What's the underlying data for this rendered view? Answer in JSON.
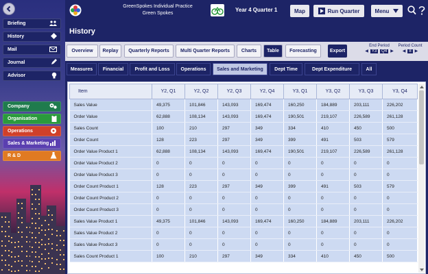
{
  "sidebar": {
    "top_items": [
      {
        "label": "Briefing",
        "icon": "people-icon"
      },
      {
        "label": "History",
        "icon": "history-icon"
      },
      {
        "label": "Mail",
        "icon": "mail-icon"
      },
      {
        "label": "Journal",
        "icon": "pen-icon"
      },
      {
        "label": "Advisor",
        "icon": "lightbulb-icon"
      }
    ],
    "dept_items": [
      {
        "label": "Company",
        "icon": "gears-icon",
        "color": "#1f7b4d"
      },
      {
        "label": "Organisation",
        "icon": "clipboard-icon",
        "color": "#2a9a3c"
      },
      {
        "label": "Operations",
        "icon": "cogs-icon",
        "color": "#d0402a"
      },
      {
        "label": "Sales & Marketing",
        "icon": "bar-chart-icon",
        "color": "#5a3fb0"
      },
      {
        "label": "R & D",
        "icon": "flask-icon",
        "color": "#e07a22"
      }
    ]
  },
  "header": {
    "title_line1": "GreenSpokes Individual Practice",
    "title_line2": "Green Spokes",
    "quarter": "Year 4 Quarter 1",
    "map_label": "Map",
    "run_label": "Run Quarter",
    "menu_label": "Menu"
  },
  "page": {
    "title": "History",
    "tabs": [
      "Overview",
      "Replay",
      "Quarterly Reports",
      "Multi Quarter Reports",
      "Charts",
      "Table",
      "Forecasting"
    ],
    "active_tab": "Table",
    "export_label": "Export",
    "end_period": {
      "label": "End Period",
      "year": "Y3",
      "quarter": "Q4"
    },
    "period_count": {
      "label": "Period Count",
      "value": "8"
    },
    "subtabs": [
      "Measures",
      "Financial",
      "Profit and Loss",
      "Operations",
      "Sales and Marketing",
      "Dept Time",
      "Dept Expenditure",
      "All"
    ],
    "active_subtab": "Sales and Marketing"
  },
  "table": {
    "columns": [
      "Item",
      "Y2, Q1",
      "Y2, Q2",
      "Y2, Q3",
      "Y2, Q4",
      "Y3, Q1",
      "Y3, Q2",
      "Y3, Q3",
      "Y3, Q4"
    ],
    "rows": [
      [
        "Sales Value",
        "49,375",
        "101,846",
        "143,093",
        "169,474",
        "160,250",
        "184,889",
        "203,111",
        "226,202"
      ],
      [
        "Order Value",
        "62,888",
        "108,134",
        "143,093",
        "169,474",
        "190,501",
        "219,107",
        "226,589",
        "261,128"
      ],
      [
        "Sales Count",
        "100",
        "210",
        "297",
        "349",
        "334",
        "410",
        "450",
        "500"
      ],
      [
        "Order Count",
        "128",
        "223",
        "297",
        "349",
        "399",
        "491",
        "503",
        "579"
      ],
      [
        "Order Value Product 1",
        "62,888",
        "108,134",
        "143,093",
        "169,474",
        "190,501",
        "219,107",
        "226,589",
        "261,128"
      ],
      [
        "Order Value Product 2",
        "0",
        "0",
        "0",
        "0",
        "0",
        "0",
        "0",
        "0"
      ],
      [
        "Order Value Product 3",
        "0",
        "0",
        "0",
        "0",
        "0",
        "0",
        "0",
        "0"
      ],
      [
        "Order Count Product 1",
        "128",
        "223",
        "297",
        "349",
        "399",
        "491",
        "503",
        "579"
      ],
      [
        "Order Count Product 2",
        "0",
        "0",
        "0",
        "0",
        "0",
        "0",
        "0",
        "0"
      ],
      [
        "Order Count Product 3",
        "0",
        "0",
        "0",
        "0",
        "0",
        "0",
        "0",
        "0"
      ],
      [
        "Sales Value Product 1",
        "49,375",
        "101,846",
        "143,093",
        "169,474",
        "160,250",
        "184,889",
        "203,111",
        "226,202"
      ],
      [
        "Sales Value Product 2",
        "0",
        "0",
        "0",
        "0",
        "0",
        "0",
        "0",
        "0"
      ],
      [
        "Sales Value Product 3",
        "0",
        "0",
        "0",
        "0",
        "0",
        "0",
        "0",
        "0"
      ],
      [
        "Sales Count Product 1",
        "100",
        "210",
        "297",
        "349",
        "334",
        "410",
        "450",
        "500"
      ]
    ]
  }
}
